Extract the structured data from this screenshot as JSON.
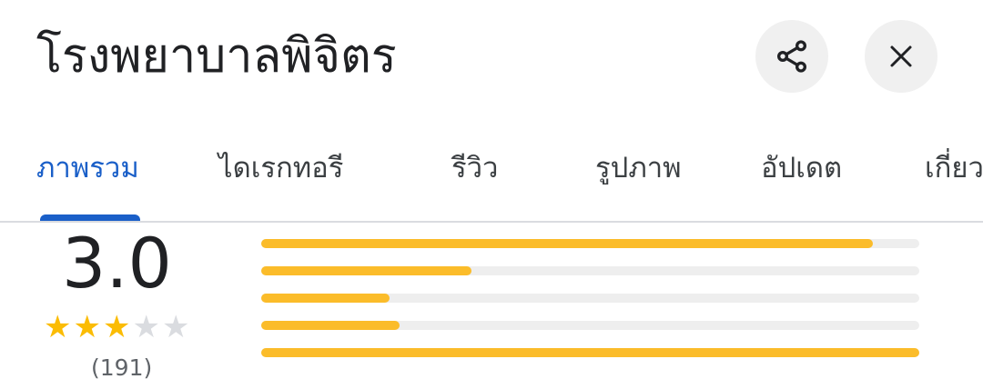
{
  "place": {
    "title": "โรงพยาบาลพิจิตร"
  },
  "actions": {
    "share_icon": "share-icon",
    "close_icon": "close-icon"
  },
  "tabs": [
    {
      "label": "ภาพรวม",
      "active": true
    },
    {
      "label": "ไดเรกทอรี",
      "active": false
    },
    {
      "label": "รีวิว",
      "active": false
    },
    {
      "label": "รูปภาพ",
      "active": false
    },
    {
      "label": "อัปเดต",
      "active": false
    },
    {
      "label": "เกี่ยว",
      "active": false
    }
  ],
  "colors": {
    "accent": "#1a5fc8",
    "star": "#fbbc04",
    "bar": "#fbbc2a",
    "track": "#eeeeee"
  },
  "rating": {
    "value": "3.0",
    "stars_filled": 3,
    "stars_total": 5,
    "review_count": "(191)",
    "distribution": [
      {
        "stars": 5,
        "fraction": 0.93
      },
      {
        "stars": 4,
        "fraction": 0.32
      },
      {
        "stars": 3,
        "fraction": 0.195
      },
      {
        "stars": 2,
        "fraction": 0.21
      },
      {
        "stars": 1,
        "fraction": 1.0
      }
    ]
  }
}
